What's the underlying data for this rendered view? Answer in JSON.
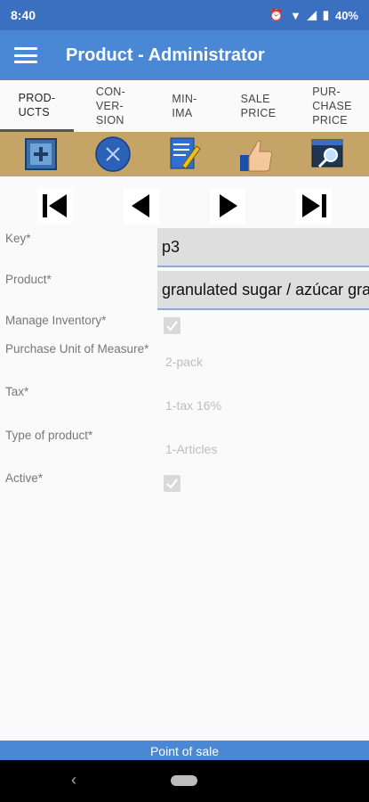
{
  "status_bar": {
    "time": "8:40",
    "battery": "40%"
  },
  "app_bar": {
    "title": "Product - Administrator"
  },
  "tabs": [
    {
      "label": "PROD-\nUCTS"
    },
    {
      "label": "CON-\nVER-\nSION"
    },
    {
      "label": "MIN-\nIMA"
    },
    {
      "label": "SALE\nPRICE"
    },
    {
      "label": "PUR-\nCHASE\nPRICE"
    }
  ],
  "toolbar_icons": [
    "add-icon",
    "cancel-icon",
    "edit-icon",
    "thumbs-up-icon",
    "search-icon"
  ],
  "nav_icons": [
    "first-record-icon",
    "previous-record-icon",
    "next-record-icon",
    "last-record-icon"
  ],
  "form": {
    "key_label": "Key*",
    "key_value": "p3",
    "product_label": "Product*",
    "product_value": "granulated sugar / azúcar granulada",
    "manage_inventory_label": "Manage Inventory*",
    "manage_inventory_checked": true,
    "purchase_unit_label": "Purchase Unit of Measure*",
    "purchase_unit_value": "2-pack",
    "tax_label": "Tax*",
    "tax_value": "1-tax 16%",
    "type_label": "Type of product*",
    "type_value": "1-Articles",
    "active_label": "Active*",
    "active_checked": true
  },
  "footer": {
    "label": "Point of sale"
  },
  "colors": {
    "app_bar": "#4a88d6",
    "status_bar": "#3b6fc0",
    "toolbar": "#c4a467"
  }
}
